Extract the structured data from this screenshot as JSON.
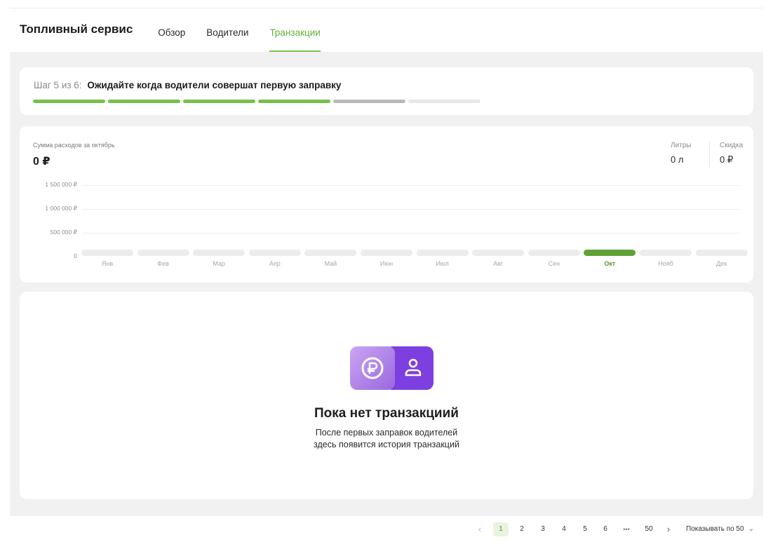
{
  "app": {
    "title": "Топливный сервис"
  },
  "tabs": [
    {
      "label": "Обзор",
      "active": false
    },
    {
      "label": "Водители",
      "active": false
    },
    {
      "label": "Транзакции",
      "active": true
    }
  ],
  "onboarding": {
    "step_label": "Шаг 5 из 6:",
    "step_title": "Ожидайте когда водители совершат первую заправку",
    "progress": {
      "completed": 4,
      "current": 5,
      "total": 6
    }
  },
  "expenses": {
    "sum_label": "Сумма расходов за октябрь",
    "sum_value": "0 ₽",
    "liters_label": "Литры",
    "liters_value": "0 л",
    "discount_label": "Скидка",
    "discount_value": "0 ₽"
  },
  "chart_data": {
    "type": "bar",
    "categories": [
      "Янв",
      "Фев",
      "Мар",
      "Апр",
      "Май",
      "Июн",
      "Июл",
      "Авг",
      "Сен",
      "Окт",
      "Нояб",
      "Дек"
    ],
    "values": [
      0,
      0,
      0,
      0,
      0,
      0,
      0,
      0,
      0,
      0,
      0,
      0
    ],
    "highlighted_category": "Окт",
    "yticks": [
      "1 500 000 ₽",
      "1 000 000 ₽",
      "500 000 ₽",
      "0"
    ],
    "ylim": [
      0,
      1500000
    ],
    "grid": true,
    "colors": {
      "highlight": "#5fa236",
      "bar": "#ececec"
    }
  },
  "empty_state": {
    "title": "Пока нет транзакциий",
    "line1": "После первых заправок водителей",
    "line2": "здесь появится история транзакций",
    "icons": [
      "ruble-coin-icon",
      "user-icon"
    ]
  },
  "pagination": {
    "prev": "‹",
    "pages": [
      "1",
      "2",
      "3",
      "4",
      "5",
      "6"
    ],
    "ellipsis": "•••",
    "last": "50",
    "next": "›",
    "current": "1",
    "page_size_label": "Показывать по 50"
  },
  "colors": {
    "accent": "#66b13a",
    "background": "#f1f1f1",
    "card": "#ffffff"
  }
}
